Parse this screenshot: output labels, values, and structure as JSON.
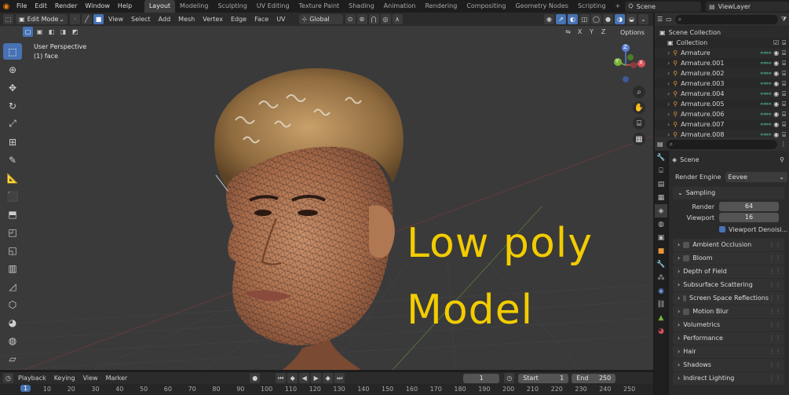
{
  "topbar": {
    "menus": [
      "File",
      "Edit",
      "Render",
      "Window",
      "Help"
    ],
    "workspaces": [
      "Layout",
      "Modeling",
      "Sculpting",
      "UV Editing",
      "Texture Paint",
      "Shading",
      "Animation",
      "Rendering",
      "Compositing",
      "Geometry Nodes",
      "Scripting"
    ],
    "active_workspace": "Layout",
    "add_tab": "+",
    "scene": "Scene",
    "view_layer": "ViewLayer"
  },
  "viewport_header": {
    "mode": "Edit Mode",
    "menus": [
      "View",
      "Select",
      "Add",
      "Mesh",
      "Vertex",
      "Edge",
      "Face",
      "UV"
    ],
    "orientation": "Global",
    "options": "Options",
    "axes": [
      "X",
      "Y",
      "Z"
    ]
  },
  "viewport": {
    "view_name": "User Perspective",
    "object_info": "(1) face",
    "overlay_line1": "Low poly",
    "overlay_line2": "Model",
    "overlay_color": "#f2cc00",
    "gizmo": {
      "x": "X",
      "y": "Y",
      "z": "Z"
    }
  },
  "outliner": {
    "scene_collection": "Scene Collection",
    "collection": "Collection",
    "items": [
      "Armature",
      "Armature.001",
      "Armature.002",
      "Armature.003",
      "Armature.004",
      "Armature.005",
      "Armature.006",
      "Armature.007",
      "Armature.008"
    ]
  },
  "properties": {
    "context": "Scene",
    "render_engine_label": "Render Engine",
    "render_engine": "Eevee",
    "sampling": "Sampling",
    "render_label": "Render",
    "render_value": "64",
    "viewport_label": "Viewport",
    "viewport_value": "16",
    "viewport_denoise": "Viewport Denoisi...",
    "panels": [
      {
        "label": "Ambient Occlusion",
        "check": true
      },
      {
        "label": "Bloom",
        "check": true
      },
      {
        "label": "Depth of Field",
        "check": false
      },
      {
        "label": "Subsurface Scattering",
        "check": false
      },
      {
        "label": "Screen Space Reflections",
        "check": true
      },
      {
        "label": "Motion Blur",
        "check": true
      },
      {
        "label": "Volumetrics",
        "check": false
      },
      {
        "label": "Performance",
        "check": false
      },
      {
        "label": "Hair",
        "check": false
      },
      {
        "label": "Shadows",
        "check": false
      },
      {
        "label": "Indirect Lighting",
        "check": false
      }
    ]
  },
  "timeline": {
    "menus": [
      "Playback",
      "Keying",
      "View",
      "Marker"
    ],
    "current_frame": "1",
    "start_label": "Start",
    "start": "1",
    "end_label": "End",
    "end": "250",
    "ticks": [
      "1",
      "10",
      "20",
      "30",
      "40",
      "50",
      "60",
      "70",
      "80",
      "90",
      "100",
      "110",
      "120",
      "130",
      "140",
      "150",
      "160",
      "170",
      "180",
      "190",
      "200",
      "210",
      "220",
      "230",
      "240",
      "250"
    ]
  }
}
